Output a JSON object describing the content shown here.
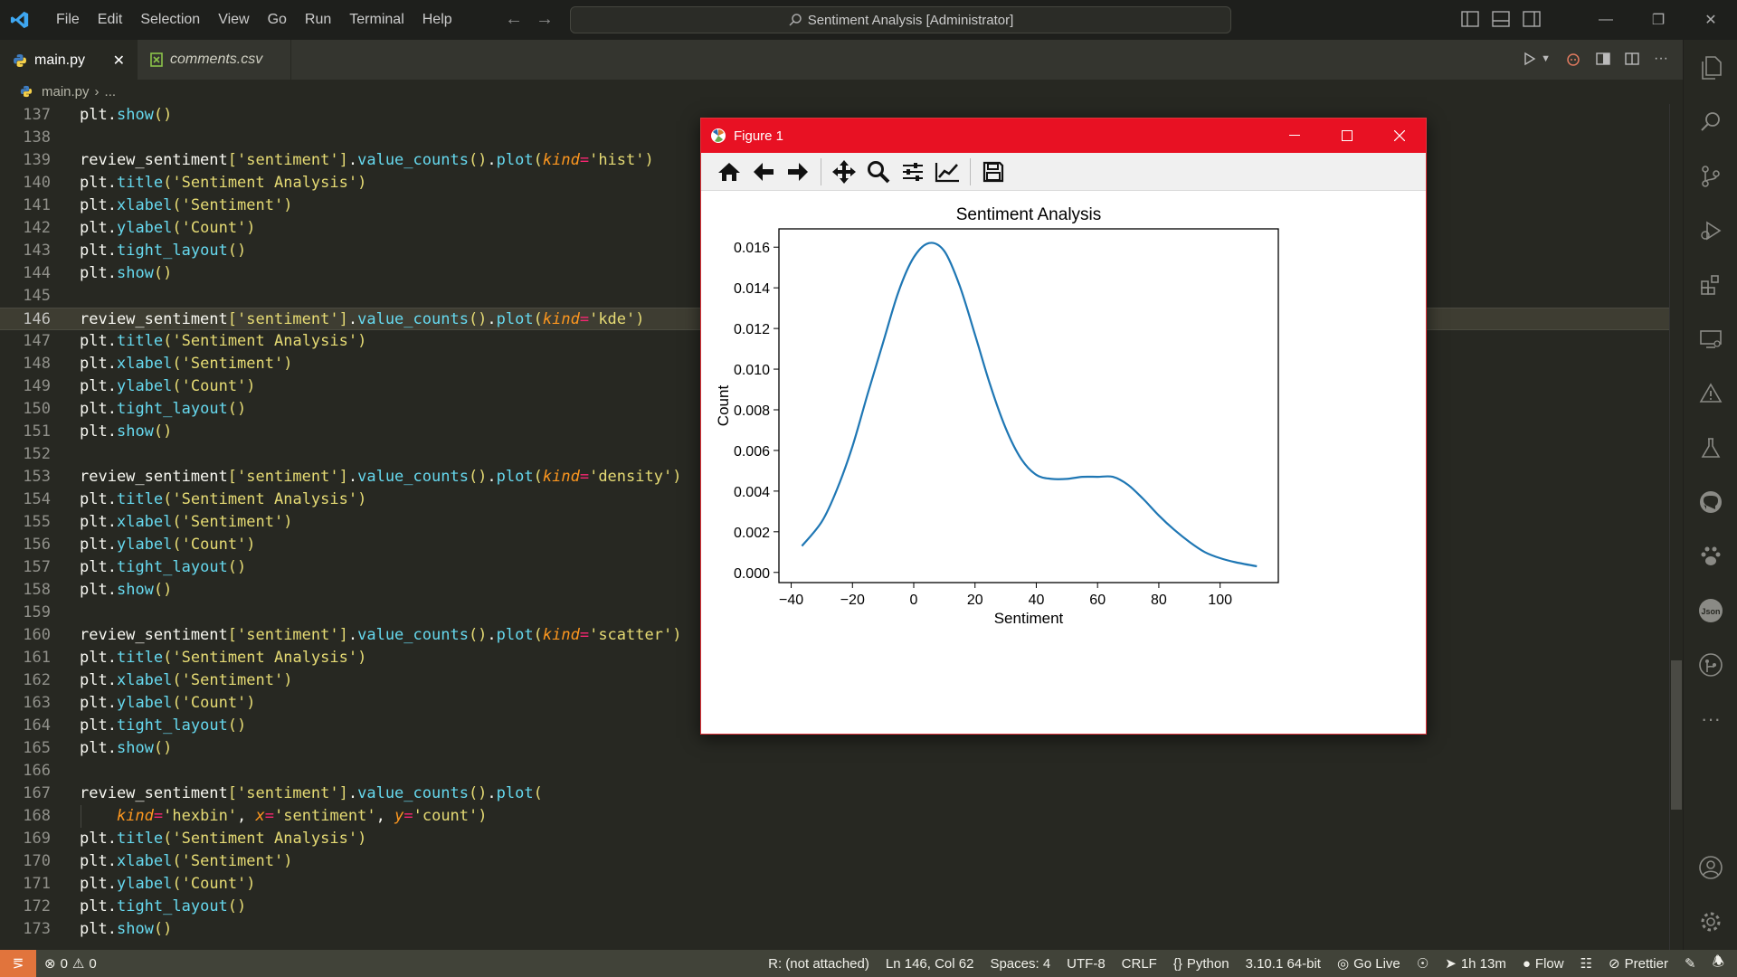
{
  "titlebar": {
    "menu": [
      "File",
      "Edit",
      "Selection",
      "View",
      "Go",
      "Run",
      "Terminal",
      "Help"
    ],
    "search_text": "Sentiment Analysis [Administrator]"
  },
  "tabs": [
    {
      "label": "main.py",
      "active": true,
      "icon": "python-icon"
    },
    {
      "label": "comments.csv",
      "active": false,
      "icon": "csv-icon"
    }
  ],
  "breadcrumb": {
    "file": "main.py",
    "rest": "..."
  },
  "editor": {
    "current_line": 146,
    "lines": [
      {
        "n": "137",
        "tokens": [
          [
            "plt",
            ""
          ],
          [
            ".",
            ""
          ],
          [
            "show",
            "fn"
          ],
          [
            "()",
            "str"
          ]
        ]
      },
      {
        "n": "138",
        "tokens": []
      },
      {
        "n": "139",
        "tokens": [
          [
            "review_sentiment",
            ""
          ],
          [
            "[",
            "str"
          ],
          [
            "'sentiment'",
            "str"
          ],
          [
            "]",
            "str"
          ],
          [
            ".",
            ""
          ],
          [
            "value_counts",
            "fn"
          ],
          [
            "()",
            "str"
          ],
          [
            ".",
            ""
          ],
          [
            "plot",
            "fn"
          ],
          [
            "(",
            "str"
          ],
          [
            "kind",
            "kw"
          ],
          [
            "=",
            "op"
          ],
          [
            "'hist'",
            "str"
          ],
          [
            ")",
            "str"
          ]
        ]
      },
      {
        "n": "140",
        "tokens": [
          [
            "plt",
            ""
          ],
          [
            ".",
            ""
          ],
          [
            "title",
            "fn"
          ],
          [
            "(",
            "str"
          ],
          [
            "'Sentiment Analysis'",
            "str"
          ],
          [
            ")",
            "str"
          ]
        ]
      },
      {
        "n": "141",
        "tokens": [
          [
            "plt",
            ""
          ],
          [
            ".",
            ""
          ],
          [
            "xlabel",
            "fn"
          ],
          [
            "(",
            "str"
          ],
          [
            "'Sentiment'",
            "str"
          ],
          [
            ")",
            "str"
          ]
        ]
      },
      {
        "n": "142",
        "tokens": [
          [
            "plt",
            ""
          ],
          [
            ".",
            ""
          ],
          [
            "ylabel",
            "fn"
          ],
          [
            "(",
            "str"
          ],
          [
            "'Count'",
            "str"
          ],
          [
            ")",
            "str"
          ]
        ]
      },
      {
        "n": "143",
        "tokens": [
          [
            "plt",
            ""
          ],
          [
            ".",
            ""
          ],
          [
            "tight_layout",
            "fn"
          ],
          [
            "()",
            "str"
          ]
        ]
      },
      {
        "n": "144",
        "tokens": [
          [
            "plt",
            ""
          ],
          [
            ".",
            ""
          ],
          [
            "show",
            "fn"
          ],
          [
            "()",
            "str"
          ]
        ]
      },
      {
        "n": "145",
        "tokens": []
      },
      {
        "n": "146",
        "tokens": [
          [
            "review_sentiment",
            ""
          ],
          [
            "[",
            "str"
          ],
          [
            "'sentiment'",
            "str"
          ],
          [
            "]",
            "str"
          ],
          [
            ".",
            ""
          ],
          [
            "value_counts",
            "fn"
          ],
          [
            "()",
            "str"
          ],
          [
            ".",
            ""
          ],
          [
            "plot",
            "fn"
          ],
          [
            "(",
            "str"
          ],
          [
            "kind",
            "kw"
          ],
          [
            "=",
            "op"
          ],
          [
            "'kde'",
            "str"
          ],
          [
            ")",
            "str"
          ]
        ]
      },
      {
        "n": "147",
        "tokens": [
          [
            "plt",
            ""
          ],
          [
            ".",
            ""
          ],
          [
            "title",
            "fn"
          ],
          [
            "(",
            "str"
          ],
          [
            "'Sentiment Analysis'",
            "str"
          ],
          [
            ")",
            "str"
          ]
        ]
      },
      {
        "n": "148",
        "tokens": [
          [
            "plt",
            ""
          ],
          [
            ".",
            ""
          ],
          [
            "xlabel",
            "fn"
          ],
          [
            "(",
            "str"
          ],
          [
            "'Sentiment'",
            "str"
          ],
          [
            ")",
            "str"
          ]
        ]
      },
      {
        "n": "149",
        "tokens": [
          [
            "plt",
            ""
          ],
          [
            ".",
            ""
          ],
          [
            "ylabel",
            "fn"
          ],
          [
            "(",
            "str"
          ],
          [
            "'Count'",
            "str"
          ],
          [
            ")",
            "str"
          ]
        ]
      },
      {
        "n": "150",
        "tokens": [
          [
            "plt",
            ""
          ],
          [
            ".",
            ""
          ],
          [
            "tight_layout",
            "fn"
          ],
          [
            "()",
            "str"
          ]
        ]
      },
      {
        "n": "151",
        "tokens": [
          [
            "plt",
            ""
          ],
          [
            ".",
            ""
          ],
          [
            "show",
            "fn"
          ],
          [
            "()",
            "str"
          ]
        ]
      },
      {
        "n": "152",
        "tokens": []
      },
      {
        "n": "153",
        "tokens": [
          [
            "review_sentiment",
            ""
          ],
          [
            "[",
            "str"
          ],
          [
            "'sentiment'",
            "str"
          ],
          [
            "]",
            "str"
          ],
          [
            ".",
            ""
          ],
          [
            "value_counts",
            "fn"
          ],
          [
            "()",
            "str"
          ],
          [
            ".",
            ""
          ],
          [
            "plot",
            "fn"
          ],
          [
            "(",
            "str"
          ],
          [
            "kind",
            "kw"
          ],
          [
            "=",
            "op"
          ],
          [
            "'density'",
            "str"
          ],
          [
            ")",
            "str"
          ]
        ]
      },
      {
        "n": "154",
        "tokens": [
          [
            "plt",
            ""
          ],
          [
            ".",
            ""
          ],
          [
            "title",
            "fn"
          ],
          [
            "(",
            "str"
          ],
          [
            "'Sentiment Analysis'",
            "str"
          ],
          [
            ")",
            "str"
          ]
        ]
      },
      {
        "n": "155",
        "tokens": [
          [
            "plt",
            ""
          ],
          [
            ".",
            ""
          ],
          [
            "xlabel",
            "fn"
          ],
          [
            "(",
            "str"
          ],
          [
            "'Sentiment'",
            "str"
          ],
          [
            ")",
            "str"
          ]
        ]
      },
      {
        "n": "156",
        "tokens": [
          [
            "plt",
            ""
          ],
          [
            ".",
            ""
          ],
          [
            "ylabel",
            "fn"
          ],
          [
            "(",
            "str"
          ],
          [
            "'Count'",
            "str"
          ],
          [
            ")",
            "str"
          ]
        ]
      },
      {
        "n": "157",
        "tokens": [
          [
            "plt",
            ""
          ],
          [
            ".",
            ""
          ],
          [
            "tight_layout",
            "fn"
          ],
          [
            "()",
            "str"
          ]
        ]
      },
      {
        "n": "158",
        "tokens": [
          [
            "plt",
            ""
          ],
          [
            ".",
            ""
          ],
          [
            "show",
            "fn"
          ],
          [
            "()",
            "str"
          ]
        ]
      },
      {
        "n": "159",
        "tokens": []
      },
      {
        "n": "160",
        "tokens": [
          [
            "review_sentiment",
            ""
          ],
          [
            "[",
            "str"
          ],
          [
            "'sentiment'",
            "str"
          ],
          [
            "]",
            "str"
          ],
          [
            ".",
            ""
          ],
          [
            "value_counts",
            "fn"
          ],
          [
            "()",
            "str"
          ],
          [
            ".",
            ""
          ],
          [
            "plot",
            "fn"
          ],
          [
            "(",
            "str"
          ],
          [
            "kind",
            "kw"
          ],
          [
            "=",
            "op"
          ],
          [
            "'scatter'",
            "str"
          ],
          [
            ")",
            "str"
          ]
        ]
      },
      {
        "n": "161",
        "tokens": [
          [
            "plt",
            ""
          ],
          [
            ".",
            ""
          ],
          [
            "title",
            "fn"
          ],
          [
            "(",
            "str"
          ],
          [
            "'Sentiment Analysis'",
            "str"
          ],
          [
            ")",
            "str"
          ]
        ]
      },
      {
        "n": "162",
        "tokens": [
          [
            "plt",
            ""
          ],
          [
            ".",
            ""
          ],
          [
            "xlabel",
            "fn"
          ],
          [
            "(",
            "str"
          ],
          [
            "'Sentiment'",
            "str"
          ],
          [
            ")",
            "str"
          ]
        ]
      },
      {
        "n": "163",
        "tokens": [
          [
            "plt",
            ""
          ],
          [
            ".",
            ""
          ],
          [
            "ylabel",
            "fn"
          ],
          [
            "(",
            "str"
          ],
          [
            "'Count'",
            "str"
          ],
          [
            ")",
            "str"
          ]
        ]
      },
      {
        "n": "164",
        "tokens": [
          [
            "plt",
            ""
          ],
          [
            ".",
            ""
          ],
          [
            "tight_layout",
            "fn"
          ],
          [
            "()",
            "str"
          ]
        ]
      },
      {
        "n": "165",
        "tokens": [
          [
            "plt",
            ""
          ],
          [
            ".",
            ""
          ],
          [
            "show",
            "fn"
          ],
          [
            "()",
            "str"
          ]
        ]
      },
      {
        "n": "166",
        "tokens": []
      },
      {
        "n": "167",
        "tokens": [
          [
            "review_sentiment",
            ""
          ],
          [
            "[",
            "str"
          ],
          [
            "'sentiment'",
            "str"
          ],
          [
            "]",
            "str"
          ],
          [
            ".",
            ""
          ],
          [
            "value_counts",
            "fn"
          ],
          [
            "()",
            "str"
          ],
          [
            ".",
            ""
          ],
          [
            "plot",
            "fn"
          ],
          [
            "(",
            "str"
          ]
        ]
      },
      {
        "n": "168",
        "indent": true,
        "tokens": [
          [
            "    ",
            ""
          ],
          [
            "kind",
            "kw"
          ],
          [
            "=",
            "op"
          ],
          [
            "'hexbin'",
            "str"
          ],
          [
            ", ",
            ""
          ],
          [
            "x",
            "kw"
          ],
          [
            "=",
            "op"
          ],
          [
            "'sentiment'",
            "str"
          ],
          [
            ", ",
            ""
          ],
          [
            "y",
            "kw"
          ],
          [
            "=",
            "op"
          ],
          [
            "'count'",
            "str"
          ],
          [
            ")",
            "str"
          ]
        ]
      },
      {
        "n": "169",
        "tokens": [
          [
            "plt",
            ""
          ],
          [
            ".",
            ""
          ],
          [
            "title",
            "fn"
          ],
          [
            "(",
            "str"
          ],
          [
            "'Sentiment Analysis'",
            "str"
          ],
          [
            ")",
            "str"
          ]
        ]
      },
      {
        "n": "170",
        "tokens": [
          [
            "plt",
            ""
          ],
          [
            ".",
            ""
          ],
          [
            "xlabel",
            "fn"
          ],
          [
            "(",
            "str"
          ],
          [
            "'Sentiment'",
            "str"
          ],
          [
            ")",
            "str"
          ]
        ]
      },
      {
        "n": "171",
        "tokens": [
          [
            "plt",
            ""
          ],
          [
            ".",
            ""
          ],
          [
            "ylabel",
            "fn"
          ],
          [
            "(",
            "str"
          ],
          [
            "'Count'",
            "str"
          ],
          [
            ")",
            "str"
          ]
        ]
      },
      {
        "n": "172",
        "tokens": [
          [
            "plt",
            ""
          ],
          [
            ".",
            ""
          ],
          [
            "tight_layout",
            "fn"
          ],
          [
            "()",
            "str"
          ]
        ]
      },
      {
        "n": "173",
        "tokens": [
          [
            "plt",
            ""
          ],
          [
            ".",
            ""
          ],
          [
            "show",
            "fn"
          ],
          [
            "()",
            "str"
          ]
        ]
      }
    ]
  },
  "figure": {
    "window_title": "Figure 1",
    "toolbar": [
      "home-icon",
      "back-icon",
      "forward-icon",
      "pan-icon",
      "zoom-icon",
      "configure-subplots-icon",
      "edit-axis-icon",
      "save-icon"
    ]
  },
  "chart_data": {
    "type": "line",
    "title": "Sentiment Analysis",
    "xlabel": "Sentiment",
    "ylabel": "Count",
    "xlim": [
      -44,
      119
    ],
    "ylim": [
      -0.0005,
      0.0169
    ],
    "xticks": [
      -40,
      -20,
      0,
      20,
      40,
      60,
      80,
      100
    ],
    "xtick_labels": [
      "−40",
      "−20",
      "0",
      "20",
      "40",
      "60",
      "80",
      "100"
    ],
    "yticks": [
      0.0,
      0.002,
      0.004,
      0.006,
      0.008,
      0.01,
      0.012,
      0.014,
      0.016
    ],
    "ytick_labels": [
      "0.000",
      "0.002",
      "0.004",
      "0.006",
      "0.008",
      "0.010",
      "0.012",
      "0.014",
      "0.016"
    ],
    "grid": false,
    "series": [
      {
        "color": "#1f77b4",
        "x": [
          -36.5,
          -30,
          -25,
          -20,
          -15,
          -10,
          -5,
          0,
          5,
          10,
          15,
          20,
          25,
          30,
          35,
          40,
          45,
          50,
          55,
          60,
          65,
          70,
          75,
          80,
          85,
          90,
          95,
          100,
          105,
          112
        ],
        "y": [
          0.0013,
          0.0025,
          0.0041,
          0.0062,
          0.0088,
          0.0113,
          0.0138,
          0.0155,
          0.0162,
          0.0158,
          0.0141,
          0.0117,
          0.0092,
          0.0071,
          0.0056,
          0.0048,
          0.0046,
          0.0046,
          0.0047,
          0.0047,
          0.0047,
          0.0043,
          0.0036,
          0.0028,
          0.0021,
          0.0015,
          0.001,
          0.0007,
          0.0005,
          0.0003
        ]
      }
    ]
  },
  "statusbar": {
    "errors": "0",
    "warnings": "0",
    "items": [
      "R: (not attached)",
      "Ln 146, Col 62",
      "Spaces: 4",
      "UTF-8",
      "CRLF",
      "Python",
      "3.10.1 64-bit",
      "Go Live",
      "1h 13m",
      "Flow",
      "Prettier"
    ]
  },
  "colors": {
    "accent": "#e81123",
    "line": "#1f77b4",
    "status_remote": "#e1743c"
  }
}
